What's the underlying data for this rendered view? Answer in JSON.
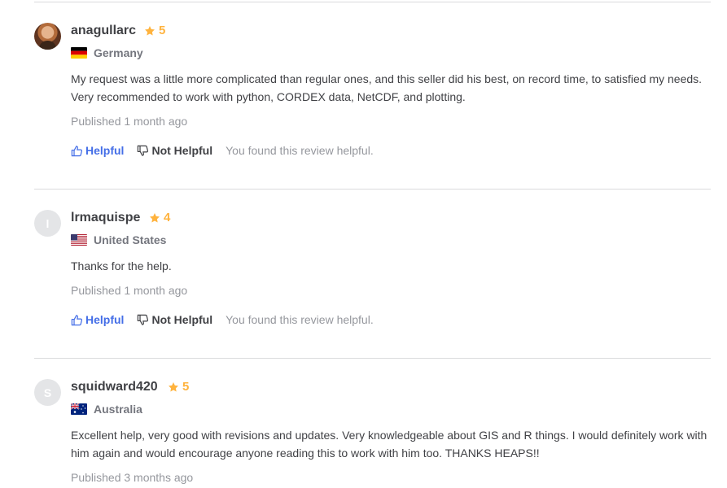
{
  "reviews": [
    {
      "username": "anagullarc",
      "rating": "5",
      "avatar_letter": "",
      "country": "Germany",
      "text": "My request was a little more complicated than regular ones, and this seller did his best, on record time, to satisfied my needs. Very recommended to work with python, CORDEX data, NetCDF, and plotting.",
      "published": "Published 1 month ago",
      "helpful_label": "Helpful",
      "not_helpful_label": "Not Helpful",
      "feedback": "You found this review helpful."
    },
    {
      "username": "lrmaquispe",
      "rating": "4",
      "avatar_letter": "l",
      "country": "United States",
      "text": "Thanks for the help.",
      "published": "Published 1 month ago",
      "helpful_label": "Helpful",
      "not_helpful_label": "Not Helpful",
      "feedback": "You found this review helpful."
    },
    {
      "username": "squidward420",
      "rating": "5",
      "avatar_letter": "S",
      "country": "Australia",
      "text": "Excellent help, very good with revisions and updates. Very knowledgeable about GIS and R things. I would definitely work with him again and would encourage anyone reading this to work with him too. THANKS HEAPS!!",
      "published": "Published 3 months ago"
    }
  ],
  "colors": {
    "star": "#ffb33e",
    "helpful": "#446ee7",
    "muted": "#95979d",
    "text": "#404145"
  },
  "icons": {
    "star": "star-icon",
    "thumbs_up": "thumbs-up-icon",
    "thumbs_down": "thumbs-down-icon"
  }
}
